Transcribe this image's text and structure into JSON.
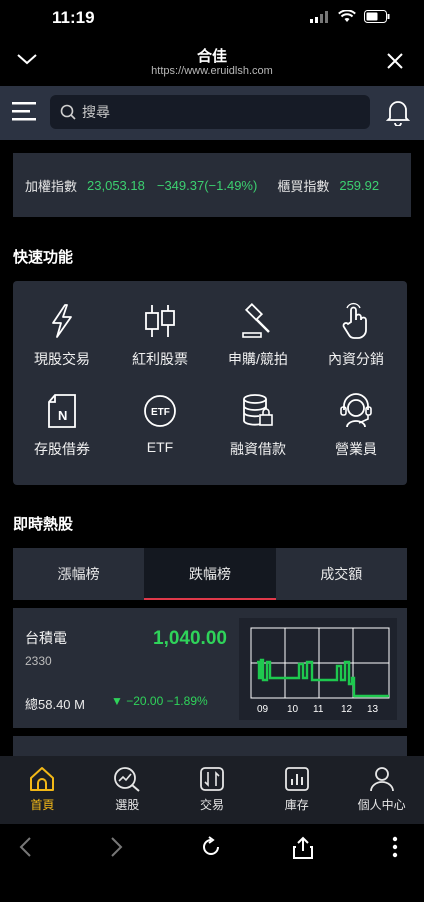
{
  "status": {
    "time": "11:19"
  },
  "browser": {
    "title": "合佳",
    "url": "https://www.eruidlsh.com"
  },
  "search": {
    "placeholder": "搜尋"
  },
  "index_strip": [
    {
      "name": "加權指數",
      "value": "23,053.18",
      "change": "−349.37(−1.49%)"
    },
    {
      "name": "櫃買指數",
      "value": "259.92"
    }
  ],
  "quick": {
    "title": "快速功能",
    "items": [
      {
        "label": "現股交易",
        "icon": "lightning-icon"
      },
      {
        "label": "紅利股票",
        "icon": "candlestick-icon"
      },
      {
        "label": "申購/競拍",
        "icon": "gavel-icon"
      },
      {
        "label": "內資分銷",
        "icon": "hand-pointer-icon"
      },
      {
        "label": "存股借券",
        "icon": "document-n-icon"
      },
      {
        "label": "ETF",
        "icon": "etf-coin-icon"
      },
      {
        "label": "融資借款",
        "icon": "database-lock-icon"
      },
      {
        "label": "營業員",
        "icon": "headset-icon"
      }
    ]
  },
  "hot": {
    "title": "即時熱股",
    "tabs": [
      "漲幅榜",
      "跌幅榜",
      "成交額"
    ],
    "active_tab": 1
  },
  "stock": {
    "name": "台積電",
    "code": "2330",
    "price": "1,040.00",
    "volume": "總58.40 M",
    "change": "−20.00",
    "change_pct": "−1.89%",
    "chart_x_labels": [
      "09",
      "10",
      "11",
      "12",
      "13"
    ]
  },
  "tabbar": {
    "items": [
      {
        "label": "首頁",
        "icon": "home-icon"
      },
      {
        "label": "選股",
        "icon": "chart-search-icon"
      },
      {
        "label": "交易",
        "icon": "trade-icon"
      },
      {
        "label": "庫存",
        "icon": "bar-chart-icon"
      },
      {
        "label": "個人中心",
        "icon": "user-icon"
      }
    ],
    "active": 0
  },
  "colors": {
    "up_green": "#2fd35a",
    "active_tab": "#f2b817",
    "tab_underline": "#e0394a",
    "panel": "#282d38"
  }
}
